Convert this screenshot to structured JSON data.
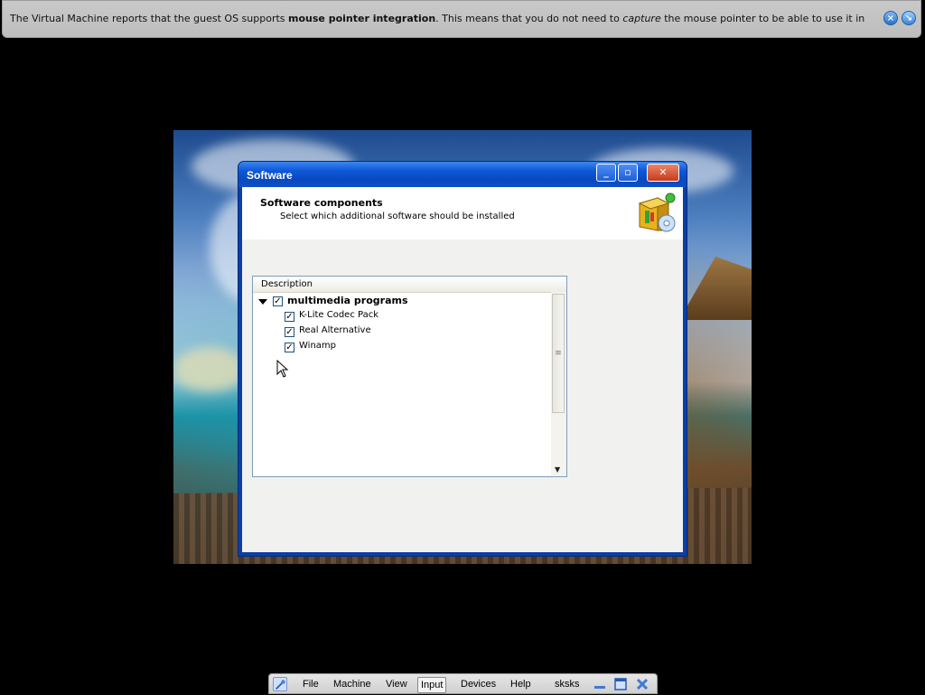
{
  "notification": {
    "prefix": "The Virtual Machine reports that the guest OS supports ",
    "bold": "mouse pointer integration",
    "middle": ". This means that you do not need to ",
    "italic": "capture",
    "suffix": " the mouse pointer to be able to use it in your guest OS -- all mouse",
    "close_icon": "close-icon",
    "dismiss_icon": "dismiss-message-icon"
  },
  "window": {
    "title": "Software",
    "minimize_icon": "minimize-icon",
    "maximize_icon": "maximize-icon",
    "close_icon": "close-icon",
    "header_title": "Software components",
    "header_subtitle": "Select which additional software should be installed",
    "header_icon": "software-package-icon"
  },
  "tree": {
    "column_header": "Description",
    "root": {
      "label": "multimedia programs",
      "checked": true,
      "expanded": true
    },
    "children": [
      {
        "label": "K-Lite Codec Pack",
        "checked": true
      },
      {
        "label": "Real Alternative",
        "checked": true
      },
      {
        "label": "Winamp",
        "checked": true
      }
    ]
  },
  "vbox_menu": {
    "items": [
      "File",
      "Machine",
      "View",
      "Input",
      "Devices",
      "Help"
    ],
    "vm_name": "sksks"
  }
}
